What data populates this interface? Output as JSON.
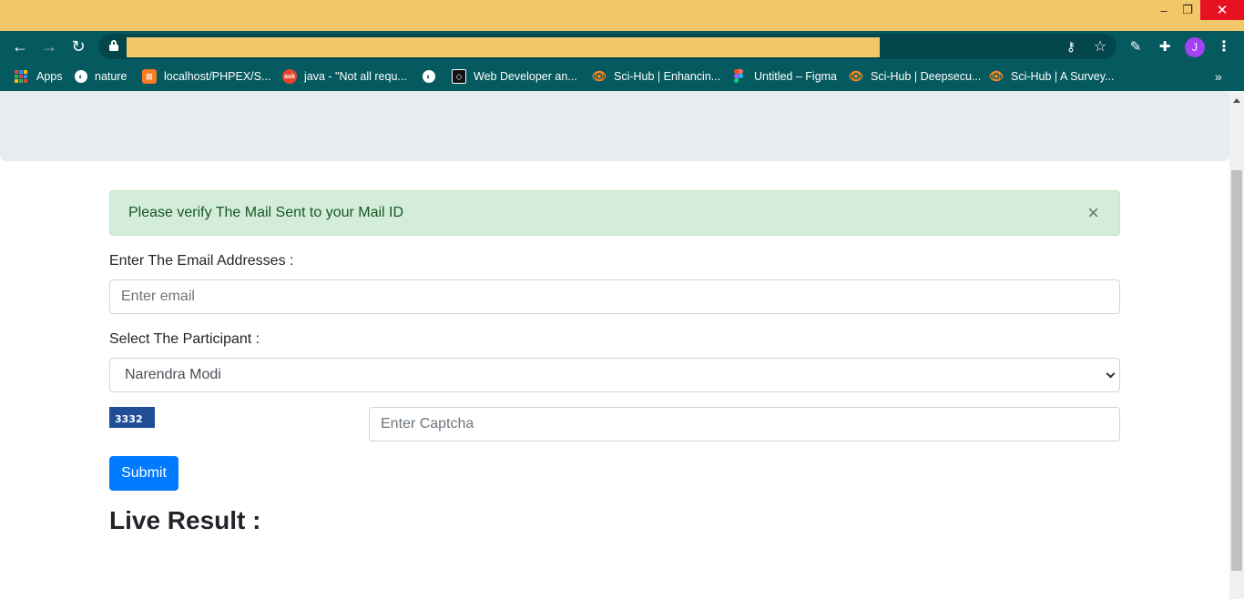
{
  "browser": {
    "window_controls": {
      "minimize": "–",
      "maximize": "❐",
      "close": "✕"
    },
    "nav": {
      "back": "←",
      "forward": "→",
      "reload": "↻"
    },
    "toolbar_icons": {
      "key": "⚷",
      "star": "☆",
      "pen": "✎",
      "puzzle": "✚",
      "menu": "⋮"
    },
    "profile_initial": "J",
    "url_bar_color": "#f2c76a",
    "theme_color": "#055a60"
  },
  "bookmarks": {
    "items": [
      {
        "label": "Apps",
        "icon": "apps-icon"
      },
      {
        "label": "nature",
        "icon": "globe-icon"
      },
      {
        "label": "localhost/PHPEX/S...",
        "icon": "xampp-icon"
      },
      {
        "label": "java - \"Not all requ...",
        "icon": "ask-icon"
      },
      {
        "label": "",
        "icon": "globe-icon"
      },
      {
        "label": "Web Developer an...",
        "icon": "webdev-icon"
      },
      {
        "label": "Sci-Hub | Enhancin...",
        "icon": "scihub-icon"
      },
      {
        "label": "Untitled – Figma",
        "icon": "figma-icon"
      },
      {
        "label": "Sci-Hub | Deepsecu...",
        "icon": "scihub-icon"
      },
      {
        "label": "Sci-Hub | A Survey...",
        "icon": "scihub-icon"
      }
    ],
    "more": "»"
  },
  "page": {
    "alert": {
      "message": "Please verify The Mail Sent to your Mail ID",
      "close": "×",
      "color": "#d4edda"
    },
    "email": {
      "label": "Enter The Email Addresses :",
      "placeholder": "Enter email",
      "value": ""
    },
    "participant": {
      "label": "Select The Participant :",
      "selected": "Narendra Modi"
    },
    "captcha": {
      "code": "3332",
      "placeholder": "Enter Captcha"
    },
    "submit_label": "Submit",
    "live_result_title": "Live Result :",
    "accent": "#007bff"
  }
}
